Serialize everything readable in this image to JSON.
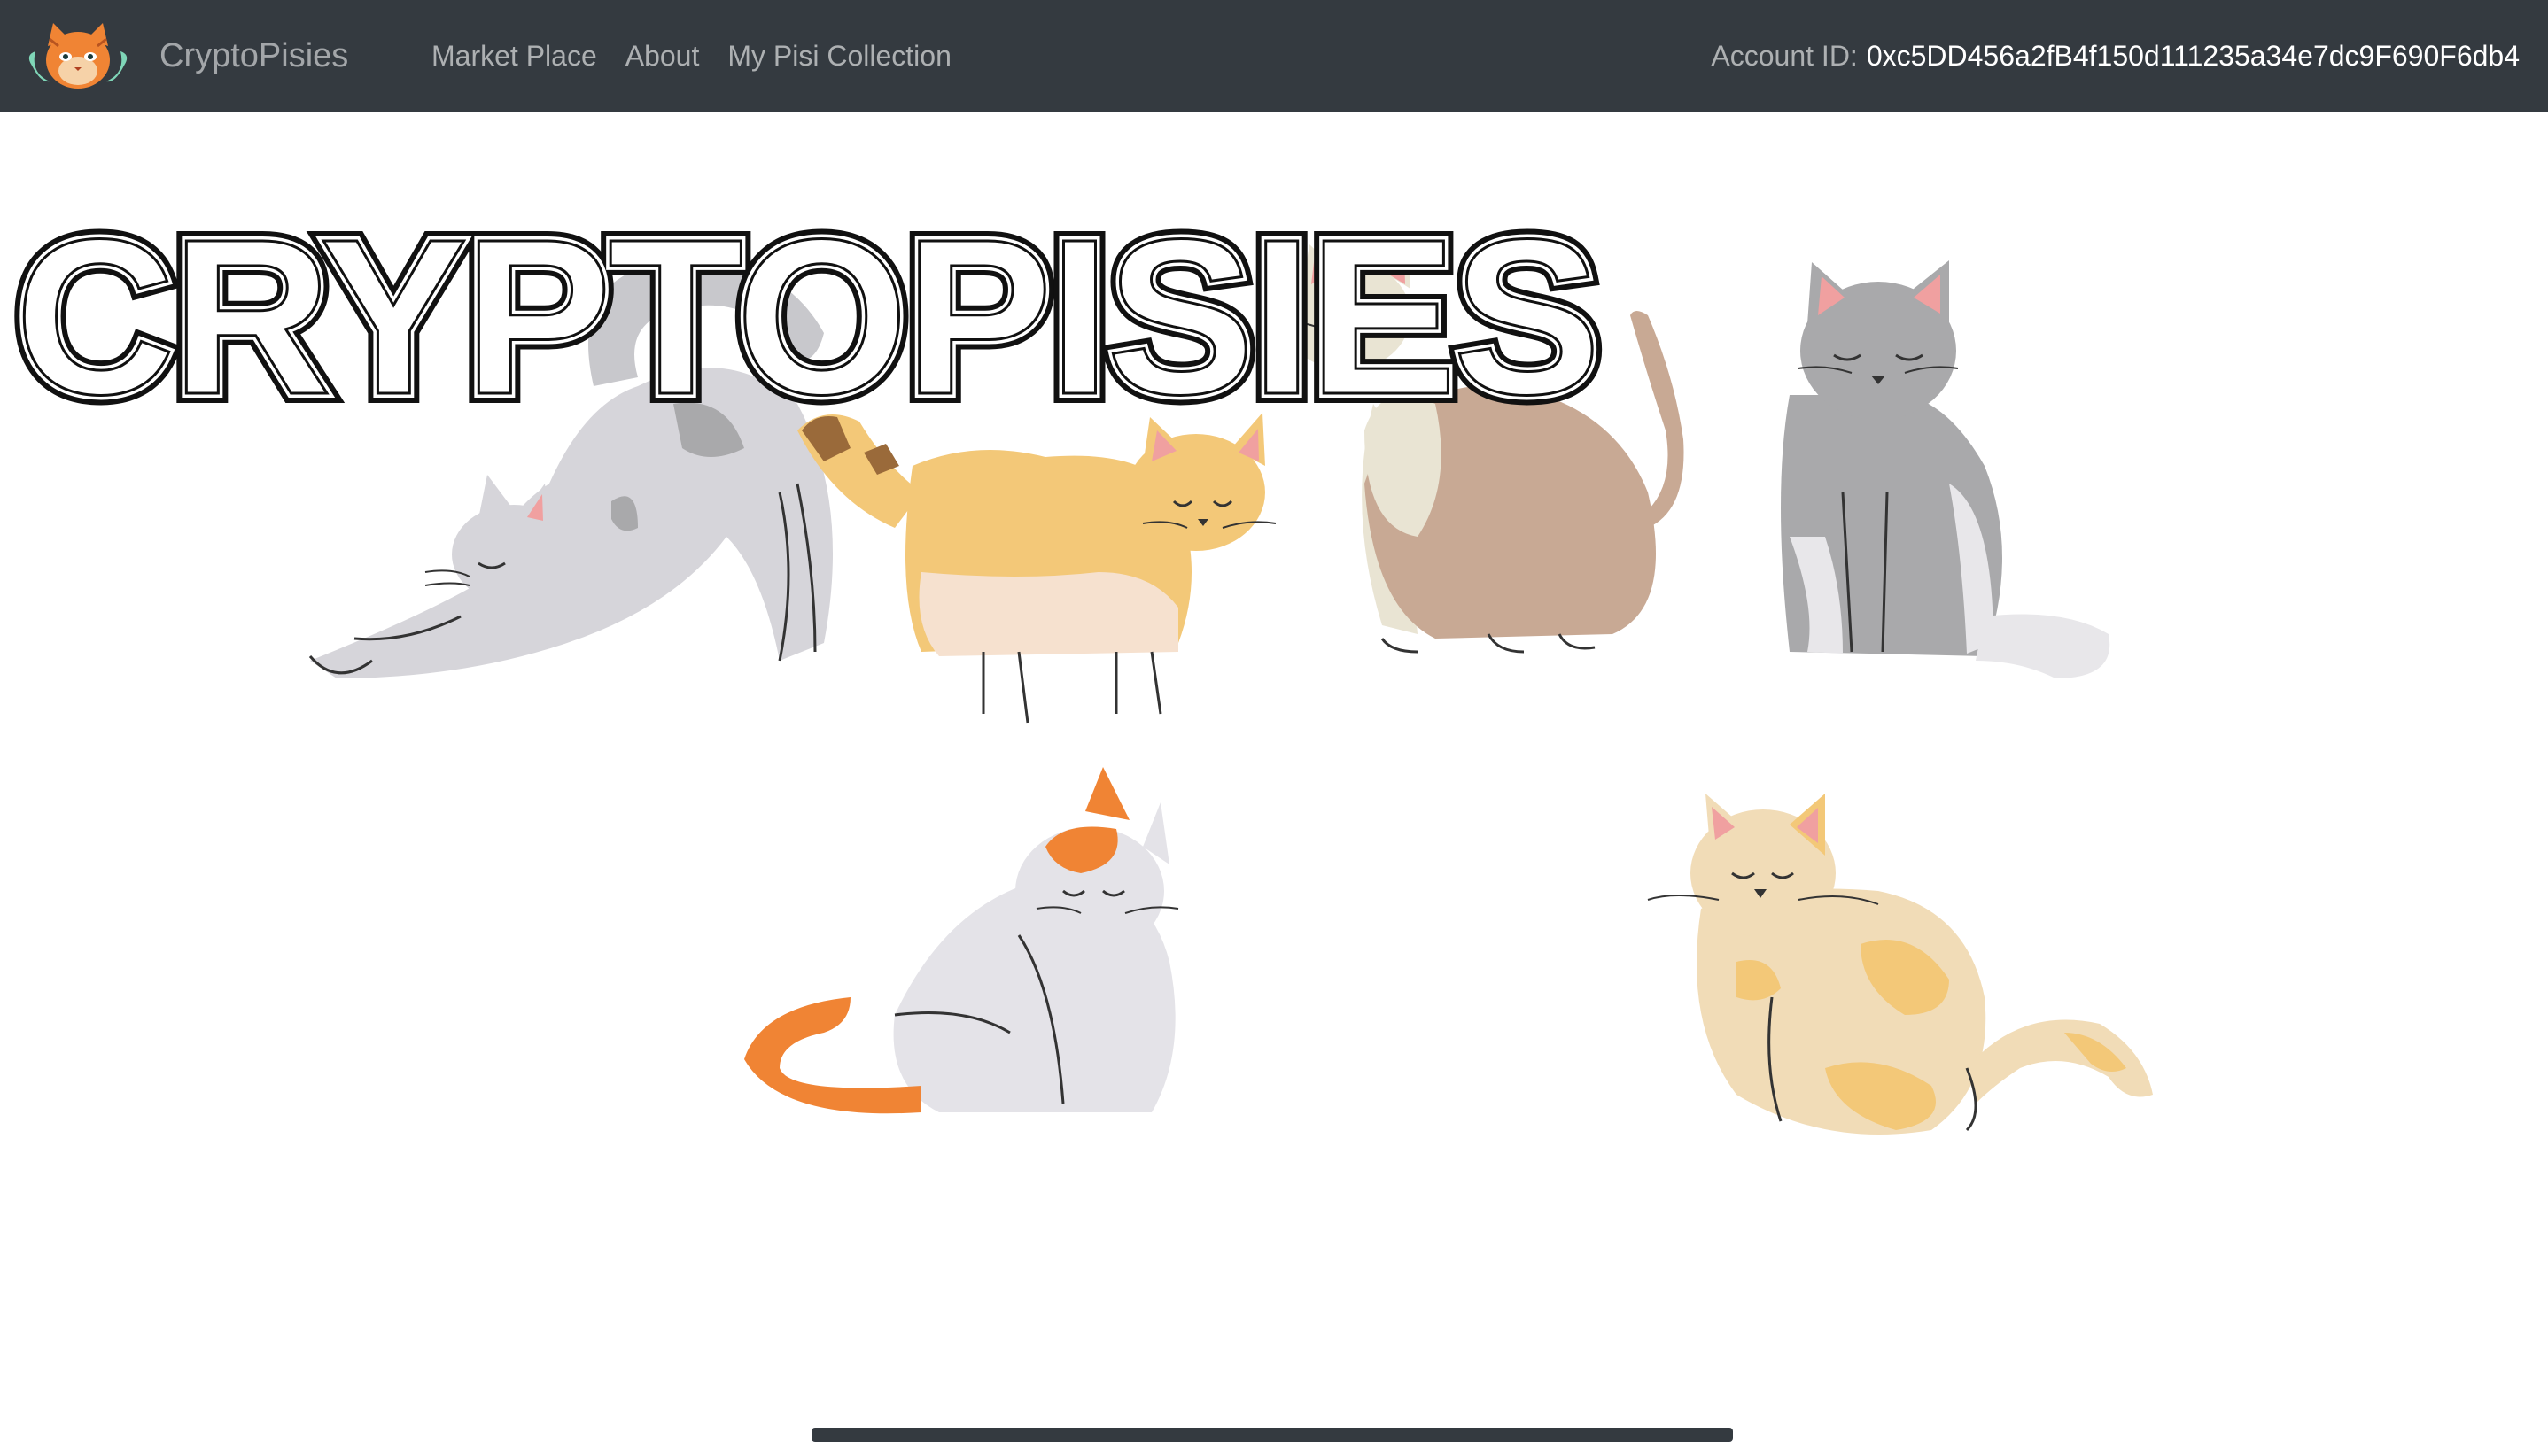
{
  "navbar": {
    "brand": "CryptoPisies",
    "links": [
      "Market Place",
      "About",
      "My Pisi Collection"
    ],
    "account_label": "Account ID:",
    "account_id": "0xc5DD456a2fB4f150d111235a34e7dc9F690F6db4"
  },
  "hero": {
    "title_art": "CRYPTOPISIES"
  },
  "colors": {
    "navbar_bg": "#343a40",
    "orange": "#f08434",
    "cream": "#f3c878",
    "grey": "#a9a9ab"
  }
}
